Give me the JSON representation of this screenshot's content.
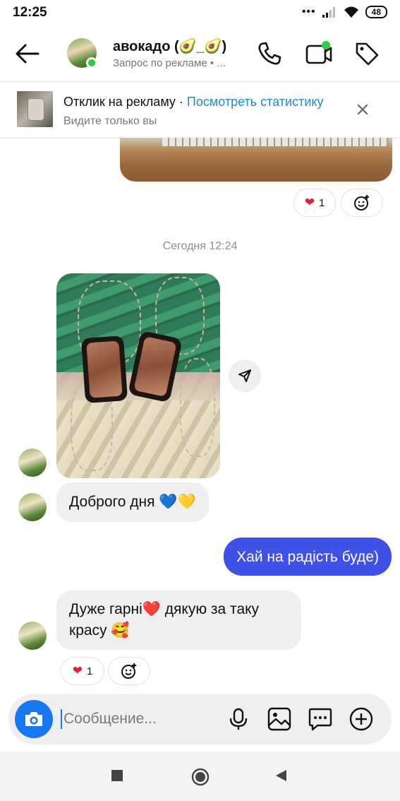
{
  "status_bar": {
    "time": "12:25",
    "dots": "•••",
    "battery": "48"
  },
  "header": {
    "title": "авокадо (🥑_🥑)",
    "subtitle": "Запрос по рекламе • ..."
  },
  "ad_banner": {
    "label": "Отклик на рекламу",
    "separator": " · ",
    "link": "Посмотреть статистику",
    "note": "Видите только вы"
  },
  "reactions_top": {
    "count": "1"
  },
  "timestamp": "Сегодня 12:24",
  "messages": {
    "greeting": "Доброго дня 💙💛",
    "outgoing": "Хай на радість буде)",
    "incoming_line1": "Дуже гарні❤️ дякую за таку",
    "incoming_line2": "красу 🥰"
  },
  "reactions_bottom": {
    "count": "1"
  },
  "composer": {
    "placeholder": "Сообщение..."
  },
  "colors": {
    "accent_blue": "#1877f2",
    "outgoing_bubble": "#3f51e6",
    "online": "#2ecc40",
    "heart": "#e0222e"
  }
}
